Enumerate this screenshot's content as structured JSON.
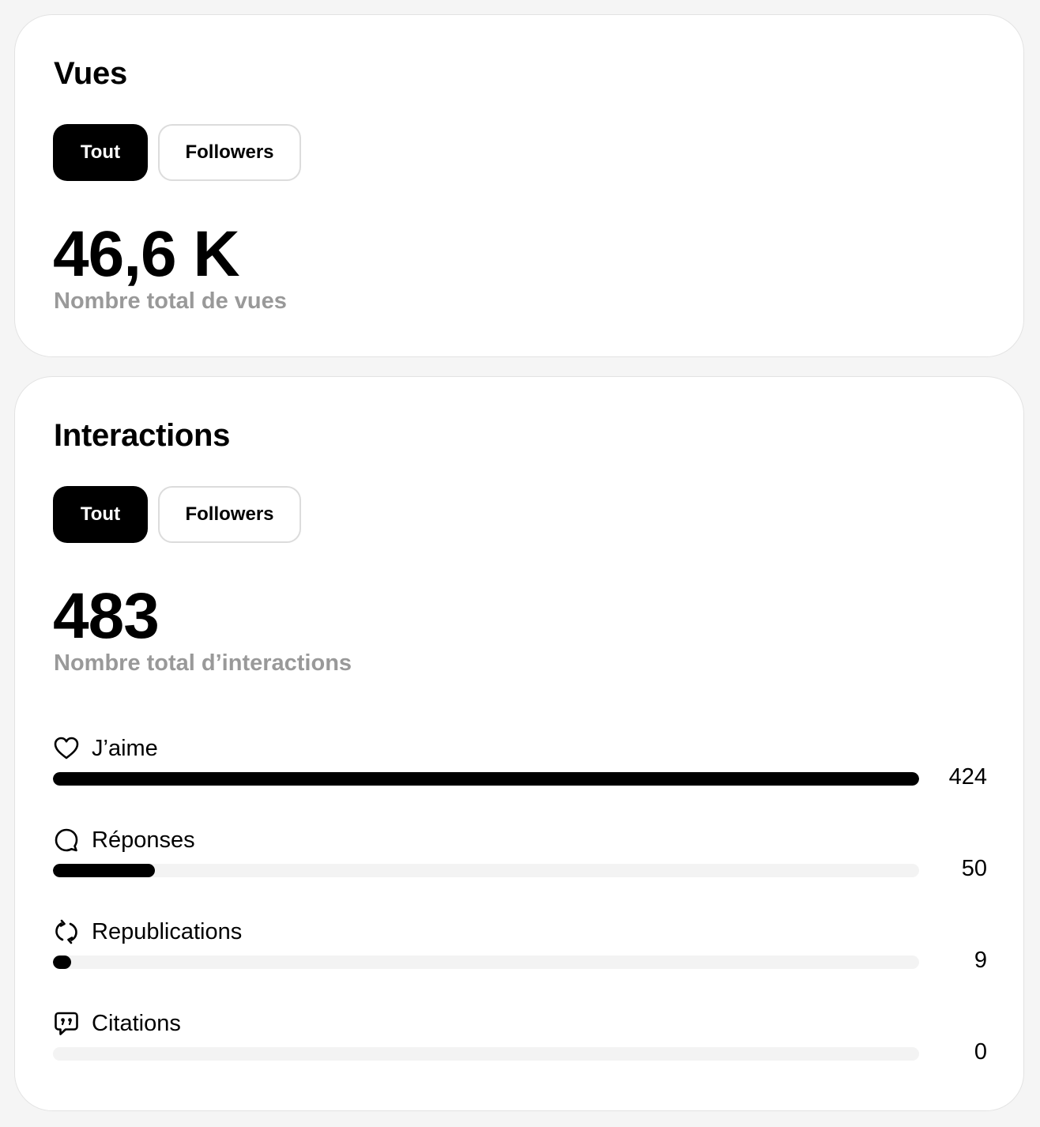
{
  "views": {
    "title": "Vues",
    "tabs": [
      {
        "label": "Tout",
        "active": true
      },
      {
        "label": "Followers",
        "active": false
      }
    ],
    "total": "46,6 K",
    "subtitle": "Nombre total de vues"
  },
  "interactions": {
    "title": "Interactions",
    "tabs": [
      {
        "label": "Tout",
        "active": true
      },
      {
        "label": "Followers",
        "active": false
      }
    ],
    "total": "483",
    "subtitle": "Nombre total d’interactions",
    "metrics": [
      {
        "label": "J’aime",
        "value": "424",
        "fraction": 1.0,
        "icon": "heart-icon"
      },
      {
        "label": "Réponses",
        "value": "50",
        "fraction": 0.118,
        "icon": "comment-icon"
      },
      {
        "label": "Republications",
        "value": "9",
        "fraction": 0.021,
        "icon": "repost-icon"
      },
      {
        "label": "Citations",
        "value": "0",
        "fraction": 0,
        "icon": "quote-icon"
      }
    ]
  },
  "colors": {
    "accent": "#000000",
    "track": "#f3f3f3",
    "muted_text": "#999999",
    "background": "#f5f5f5"
  }
}
